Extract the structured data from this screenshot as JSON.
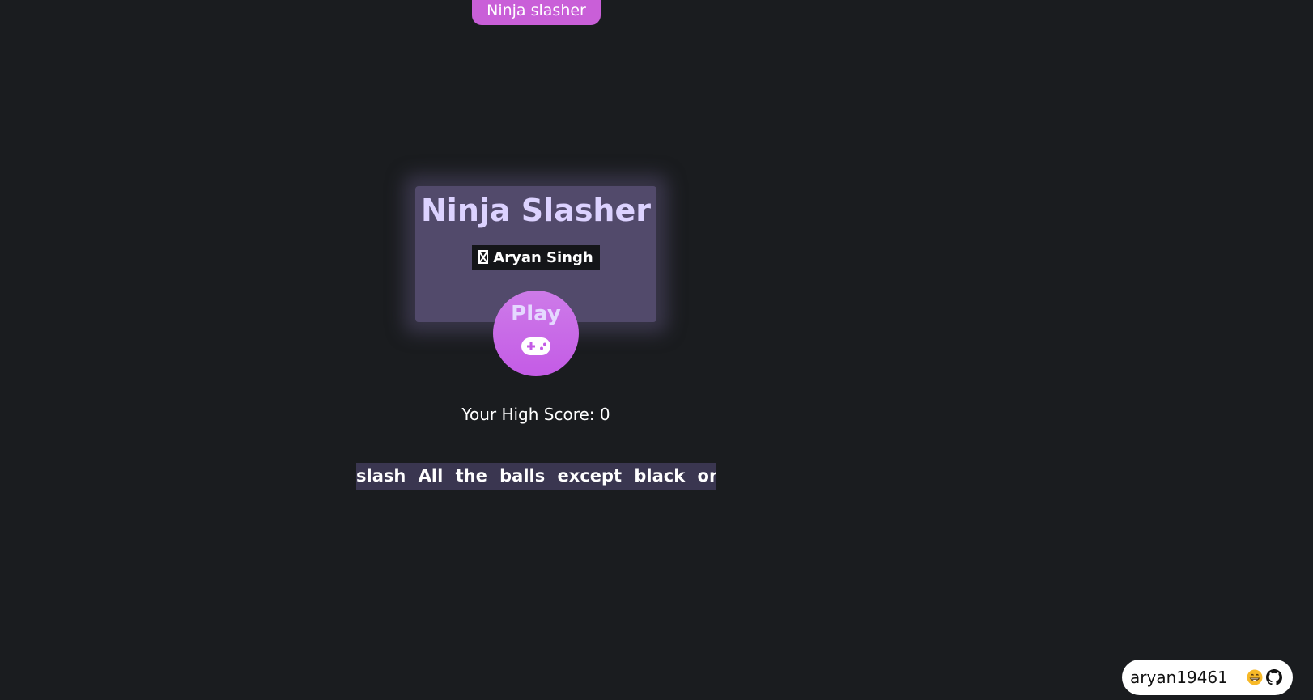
{
  "top_tab": {
    "label": "Ninja slasher"
  },
  "card": {
    "title": "Ninja Slasher",
    "author": "Aryan Singh"
  },
  "play_button": {
    "label": "Play",
    "icon": "gamepad-icon"
  },
  "high_score": {
    "text": "Your High Score: 0"
  },
  "instructions": {
    "text": "slash All the balls except black one"
  },
  "footer": {
    "username": "aryan19461",
    "icons": [
      "grin-emoji-icon",
      "github-icon"
    ]
  },
  "colors": {
    "background": "#1a1c1f",
    "accent_pink": "#c95fd8",
    "play_purple": "#c45be6",
    "card": "#524a6b",
    "title_text": "#dcd2ff",
    "instruction_bg": "#3a3650"
  }
}
